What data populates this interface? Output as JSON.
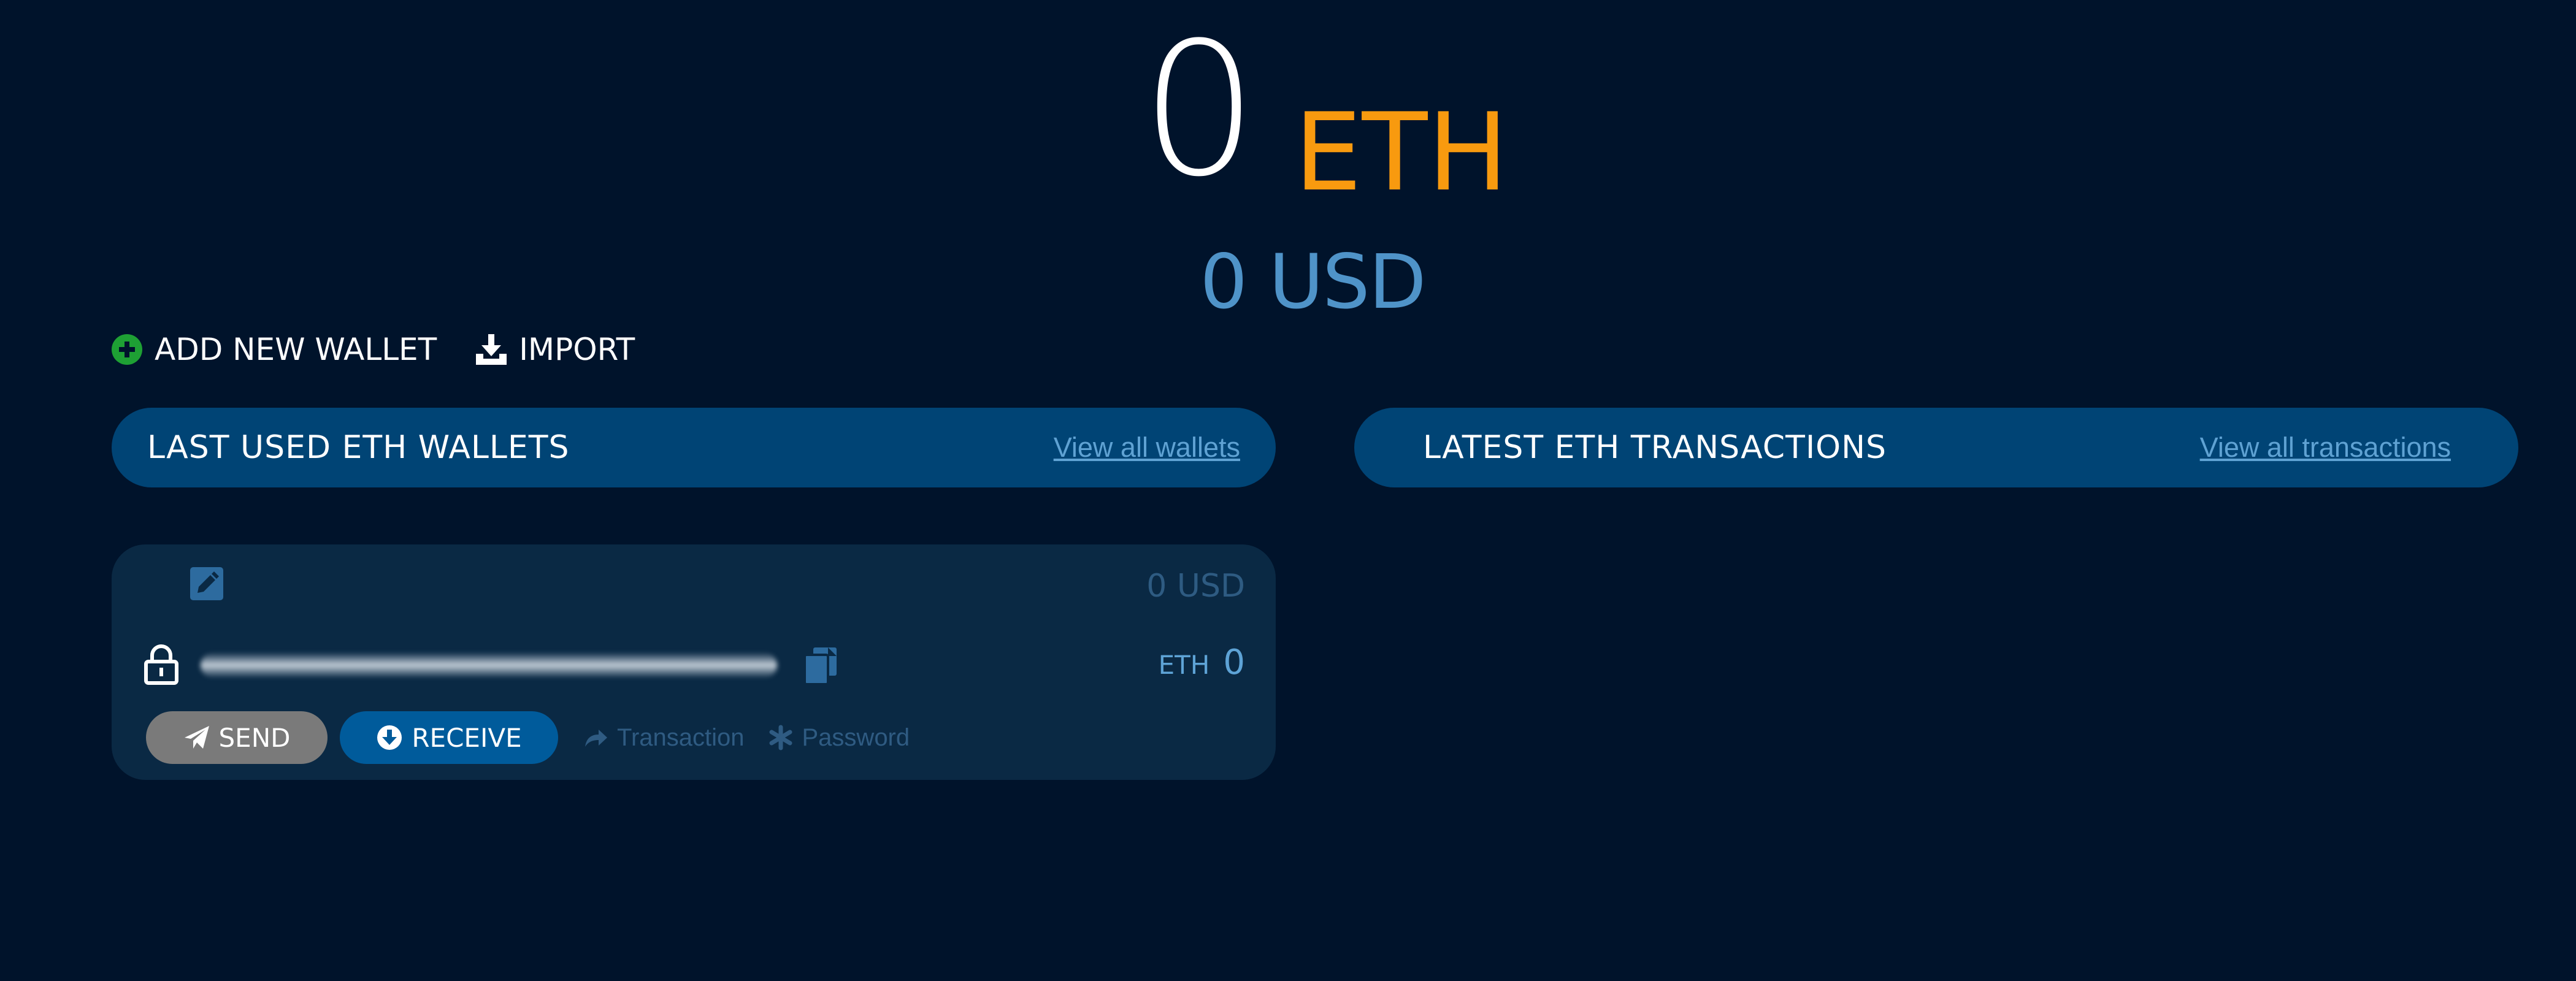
{
  "balance": {
    "amount": "0",
    "currency": "ETH",
    "usd": "0 USD"
  },
  "actions": {
    "add_wallet": "ADD NEW WALLET",
    "import": "IMPORT"
  },
  "wallets_panel": {
    "title": "LAST USED ETH WALLETS",
    "link": "View all wallets"
  },
  "transactions_panel": {
    "title": "LATEST ETH TRANSACTIONS",
    "link": "View all transactions"
  },
  "wallet": {
    "usd": "0 USD",
    "currency": "ETH",
    "value": "0",
    "send_label": "SEND",
    "receive_label": "RECEIVE",
    "transaction_label": "Transaction",
    "password_label": "Password"
  },
  "icons": {
    "add": "plus-circle-icon",
    "import": "download-icon",
    "edit": "pencil-square-icon",
    "lock": "lock-icon",
    "copy": "copy-icon",
    "send": "paper-plane-icon",
    "receive": "arrow-down-circle-icon",
    "transaction": "share-arrow-icon",
    "password": "asterisk-icon"
  },
  "colors": {
    "background": "#00132b",
    "accent_eth": "#f89a0f",
    "usd_text": "#4f93c8",
    "panel_header": "#004475",
    "card": "#0a2944",
    "receive_button": "#005b9b",
    "send_button": "#7a7a7a",
    "add_icon": "#1ea034"
  }
}
